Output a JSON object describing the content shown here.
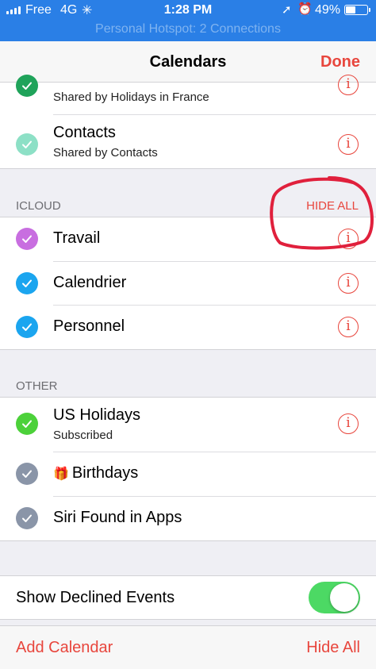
{
  "status_bar": {
    "carrier": "Free",
    "network": "4G",
    "time": "1:28 PM",
    "battery": "49%",
    "battery_level": 0.49,
    "hotspot": "Personal Hotspot: 2 Connections"
  },
  "nav": {
    "title": "Calendars",
    "done": "Done"
  },
  "top_section": {
    "rows": [
      {
        "subtitle": "Shared by Holidays in France",
        "color": "#1fa35a"
      },
      {
        "label": "Contacts",
        "subtitle": "Shared by Contacts",
        "color": "#8de0c6"
      }
    ]
  },
  "icloud": {
    "header": "ICLOUD",
    "hide_all": "HIDE ALL",
    "rows": [
      {
        "label": "Travail",
        "color": "#c86ee0"
      },
      {
        "label": "Calendrier",
        "color": "#1ba5ef"
      },
      {
        "label": "Personnel",
        "color": "#1ba5ef"
      }
    ]
  },
  "other": {
    "header": "OTHER",
    "rows": [
      {
        "label": "US Holidays",
        "subtitle": "Subscribed",
        "color": "#4cd13a"
      },
      {
        "label": "Birthdays",
        "color": "#8a95a8"
      },
      {
        "label": "Siri Found in Apps",
        "color": "#8a95a8"
      }
    ]
  },
  "settings": {
    "show_declined": "Show Declined Events",
    "show_declined_on": true
  },
  "toolbar": {
    "add_calendar": "Add Calendar",
    "hide_all": "Hide All"
  },
  "info_glyph": "i",
  "icons": {
    "check": "checkmark-icon",
    "info": "info-circle-icon",
    "gift": "gift-icon",
    "location": "location-arrow-icon",
    "alarm": "alarm-clock-icon",
    "battery": "battery-icon",
    "signal": "signal-bars-icon",
    "activity": "activity-spinner-icon"
  },
  "colors": {
    "accent": "#e8463d",
    "status_bar": "#2a7fe6",
    "toggle_on": "#4cd964",
    "annotation": "#e0203c"
  }
}
